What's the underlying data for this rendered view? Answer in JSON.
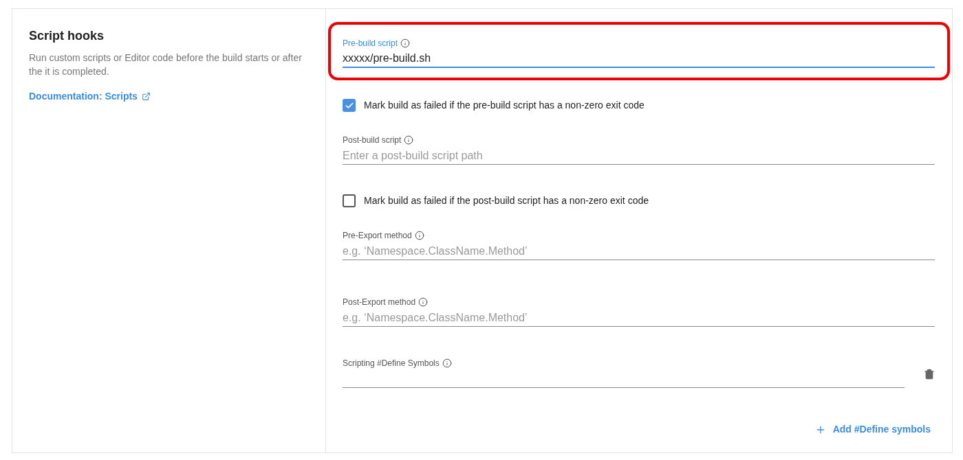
{
  "section": {
    "title": "Script hooks",
    "description": "Run custom scripts or Editor code before the build starts or after the it is completed.",
    "link": "Documentation: Scripts"
  },
  "items": [
    {
      "kind": "field",
      "label": "Pre-build script",
      "value": "xxxxx/pre-build.sh",
      "focused": true,
      "highlighted": true
    },
    {
      "kind": "checkbox",
      "label": "Mark build as failed if the pre-build script has a non-zero exit code",
      "checked": true
    },
    {
      "kind": "field",
      "label": "Post-build script",
      "placeholder": "Enter a post-build script path",
      "focused": false,
      "highlighted": false
    },
    {
      "kind": "checkbox",
      "label": "Mark build as failed if the post-build script has a non-zero exit code",
      "checked": false
    },
    {
      "kind": "field",
      "label": "Pre-Export method",
      "placeholder": "e.g. ‘Namespace.ClassName.Method’",
      "focused": false,
      "highlighted": false
    },
    {
      "kind": "field",
      "label": "Post-Export method",
      "placeholder": "e.g. ‘Namespace.ClassName.Method’",
      "focused": false,
      "highlighted": false
    },
    {
      "kind": "symbol",
      "label": "Scripting #Define Symbols",
      "focused": false,
      "highlighted": false
    }
  ],
  "add_button": "Add #Define symbols"
}
